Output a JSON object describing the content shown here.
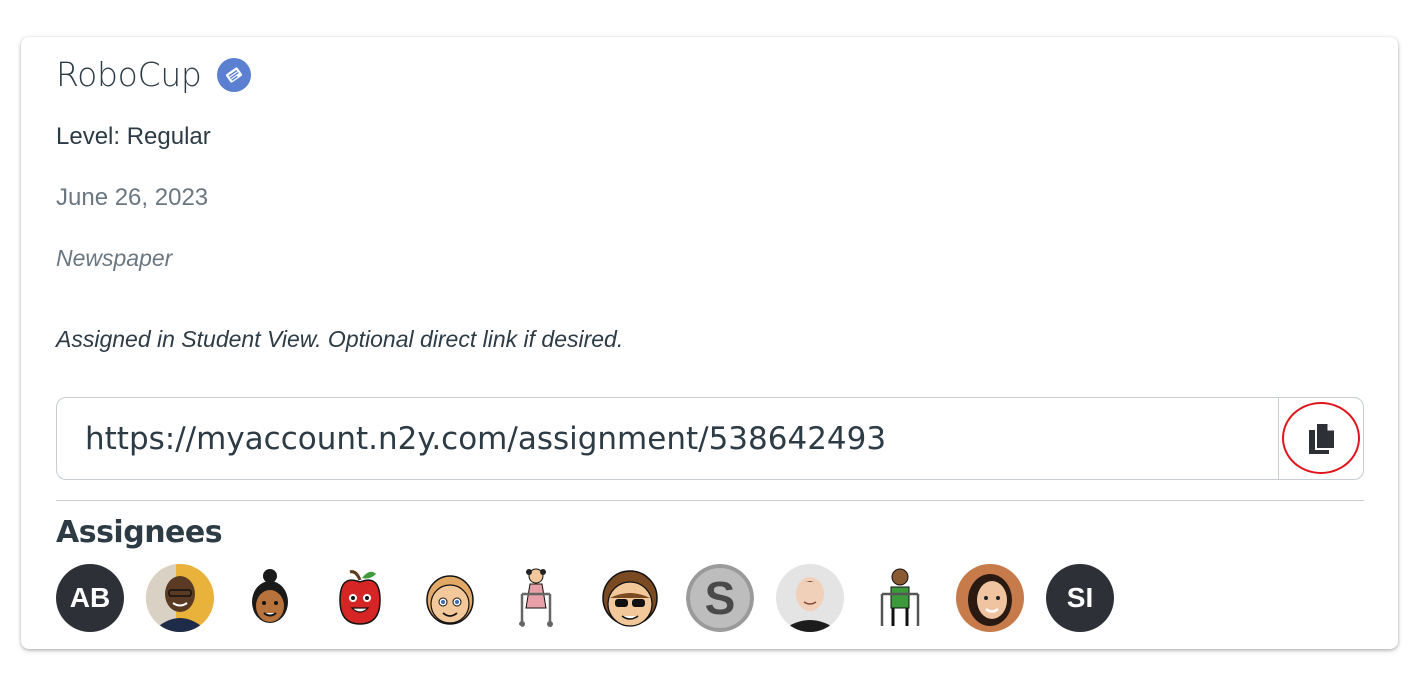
{
  "card": {
    "title": "RoboCup",
    "resource_icon": "newspaper-badge-icon",
    "level": "Level: Regular",
    "date": "June 26, 2023",
    "type": "Newspaper",
    "note": "Assigned in Student View. Optional direct link if desired.",
    "link": {
      "value": "https://myaccount.n2y.com/assignment/538642493",
      "copy_icon": "copy-icon"
    }
  },
  "assignees": {
    "title": "Assignees",
    "items": [
      {
        "initials": "AB",
        "kind": "initials"
      },
      {
        "kind": "photo",
        "icon": "student-photo-1"
      },
      {
        "kind": "symbol",
        "icon": "girl-bun-icon"
      },
      {
        "kind": "symbol",
        "icon": "apple-face-icon"
      },
      {
        "kind": "symbol",
        "icon": "blond-boy-icon"
      },
      {
        "kind": "symbol",
        "icon": "girl-walker-icon"
      },
      {
        "kind": "symbol",
        "icon": "sunglasses-boy-icon"
      },
      {
        "kind": "symbol",
        "icon": "letter-s-icon"
      },
      {
        "kind": "photo",
        "icon": "student-photo-2"
      },
      {
        "kind": "symbol",
        "icon": "boy-walker-icon"
      },
      {
        "kind": "photo",
        "icon": "student-photo-3"
      },
      {
        "initials": "SI",
        "kind": "initials"
      }
    ]
  },
  "colors": {
    "accent_ring": "#e0161c",
    "badge": "#5b7fd1",
    "initials_bg": "#2d3036"
  }
}
